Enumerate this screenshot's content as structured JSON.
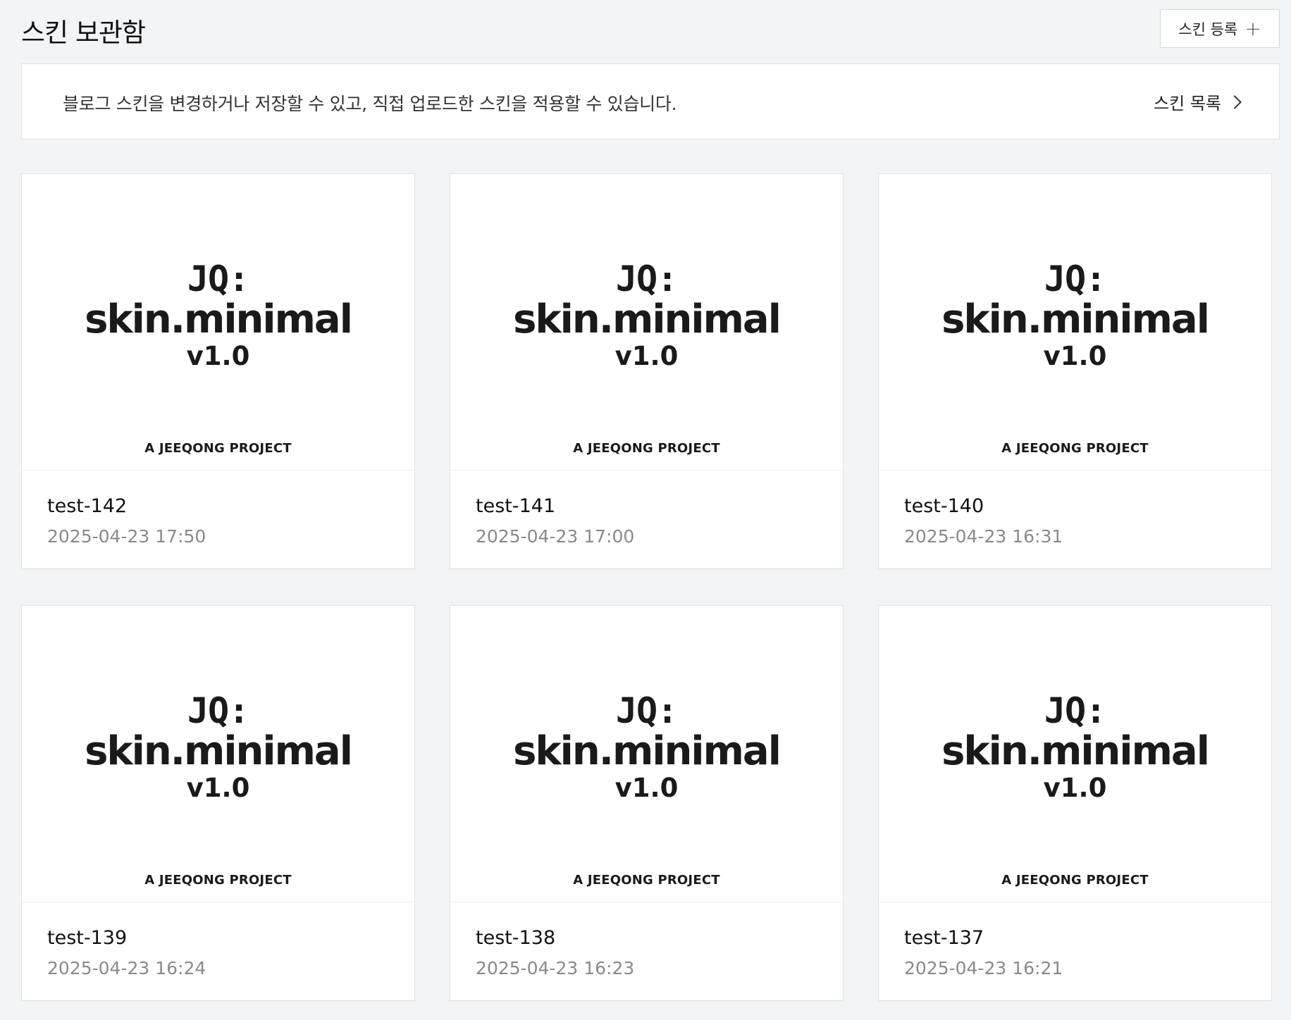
{
  "header": {
    "title": "스킨 보관함",
    "register_label": "스킨 등록",
    "register_icon": "plus-icon"
  },
  "info": {
    "text": "블로그 스킨을 변경하거나 저장할 수 있고, 직접 업로드한 스킨을 적용할 수 있습니다.",
    "link_label": "스킨 목록",
    "link_icon": "chevron-right-icon"
  },
  "thumbnail": {
    "line1": "JQ:",
    "line2": "skin.minimal",
    "line3": "v1.0",
    "credit": "A JEEQONG PROJECT"
  },
  "skins": [
    {
      "name": "test-142",
      "date": "2025-04-23 17:50"
    },
    {
      "name": "test-141",
      "date": "2025-04-23 17:00"
    },
    {
      "name": "test-140",
      "date": "2025-04-23 16:31"
    },
    {
      "name": "test-139",
      "date": "2025-04-23 16:24"
    },
    {
      "name": "test-138",
      "date": "2025-04-23 16:23"
    },
    {
      "name": "test-137",
      "date": "2025-04-23 16:21"
    }
  ]
}
